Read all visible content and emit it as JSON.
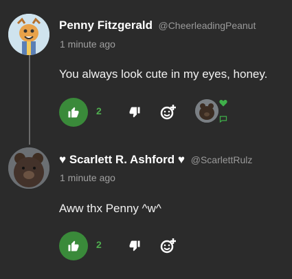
{
  "comments": [
    {
      "name": "Penny Fitzgerald",
      "handle": "@CheerleadingPeanut",
      "time": "1 minute ago",
      "text": "You always look cute in my eyes, honey.",
      "likes": "2",
      "liked": true,
      "has_reactor": true
    },
    {
      "name_prefix": "♥",
      "name": "Scarlett R. Ashford",
      "name_suffix": "♥",
      "handle": "@ScarlettRulz",
      "time": "1 minute ago",
      "text": "Aww thx Penny ^w^",
      "likes": "2",
      "liked": true
    }
  ],
  "colors": {
    "background": "#2b2b2b",
    "like_active": "#3a8a3a",
    "like_count": "#4fae4f",
    "muted_text": "#9a9a9a"
  },
  "icons": [
    "thumbs-up-icon",
    "thumbs-down-icon",
    "add-reaction-icon",
    "heart-icon",
    "chat-bubble-icon"
  ]
}
